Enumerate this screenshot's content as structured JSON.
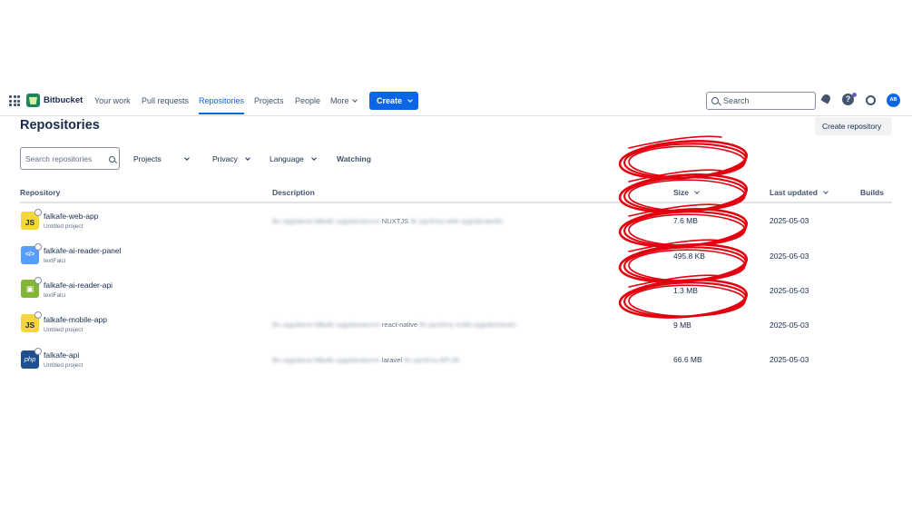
{
  "nav": {
    "brand": "Bitbucket",
    "links": [
      "Your work",
      "Pull requests",
      "Repositories",
      "Projects",
      "People",
      "More"
    ],
    "create_label": "Create",
    "search_placeholder": "Search",
    "avatar_initials": "AB",
    "help_glyph": "?"
  },
  "page": {
    "title": "Repositories",
    "create_repo_label": "Create repository"
  },
  "filters": {
    "search_placeholder": "Search repositories",
    "projects": "Projects",
    "privacy": "Privacy",
    "language": "Language",
    "watching": "Watching"
  },
  "table": {
    "headers": {
      "repository": "Repository",
      "description": "Description",
      "size": "Size",
      "last_updated": "Last updated",
      "builds": "Builds"
    },
    "rows": [
      {
        "icon": "js-icon",
        "icon_text": "JS",
        "name": "falkafe-web-app",
        "project": "Untitled project",
        "desc_blurred": "Bu uygulama falkafe uygulamasının",
        "desc_visible": "NUXTJS",
        "desc_tail": "ile yazılmış web uygulamasıdır.",
        "size": "7.6 MB",
        "updated": "2025-05-03"
      },
      {
        "icon": "code-icon",
        "icon_text": "</>",
        "name": "falkafe-ai-reader-panel",
        "project": "textFalci",
        "desc_blurred": "",
        "desc_visible": "",
        "desc_tail": "",
        "size": "495.8 KB",
        "updated": "2025-05-03"
      },
      {
        "icon": "android-icon",
        "icon_text": "▣",
        "name": "falkafe-ai-reader-api",
        "project": "textFalci",
        "desc_blurred": "",
        "desc_visible": "",
        "desc_tail": "",
        "size": "1.3 MB",
        "updated": "2025-05-03"
      },
      {
        "icon": "js-icon",
        "icon_text": "JS",
        "name": "falkafe-mobile-app",
        "project": "Untitled project",
        "desc_blurred": "Bu uygulama falkafe uygulamasının",
        "desc_visible": "react-native",
        "desc_tail": "ile yazılmış mobil uygulamasıdır.",
        "size": "9 MB",
        "updated": "2025-05-03"
      },
      {
        "icon": "php-icon",
        "icon_text": "php",
        "name": "falkafe-api",
        "project": "Untitled project",
        "desc_blurred": "Bu uygulama falkafe uygulamasının",
        "desc_visible": "laravel",
        "desc_tail": "ile yazılmış API dir.",
        "size": "66.6 MB",
        "updated": "2025-05-03"
      }
    ]
  },
  "annotation": {
    "color": "#e3000f",
    "count": 5
  }
}
